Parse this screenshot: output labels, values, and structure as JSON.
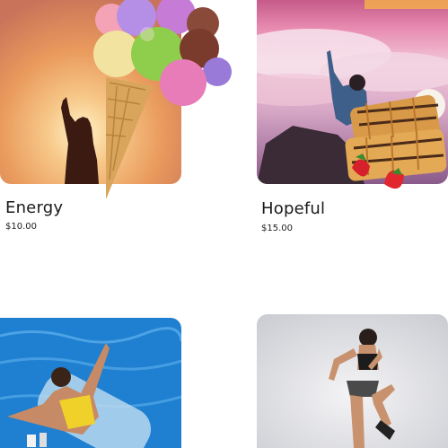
{
  "products": [
    {
      "title": "Energy",
      "price": "$10.00",
      "image": "sunset-silhouette-with-ice-cream-cone"
    },
    {
      "title": "Hopeful",
      "price": "$15.00",
      "image": "mountain-summit-with-waffles"
    },
    {
      "title": "",
      "price": "",
      "image": "woman-on-pool-float"
    },
    {
      "title": "",
      "price": "",
      "image": "woman-exercising-studio"
    }
  ],
  "colors": {
    "text": "#1a1a1a",
    "background": "#ffffff"
  }
}
